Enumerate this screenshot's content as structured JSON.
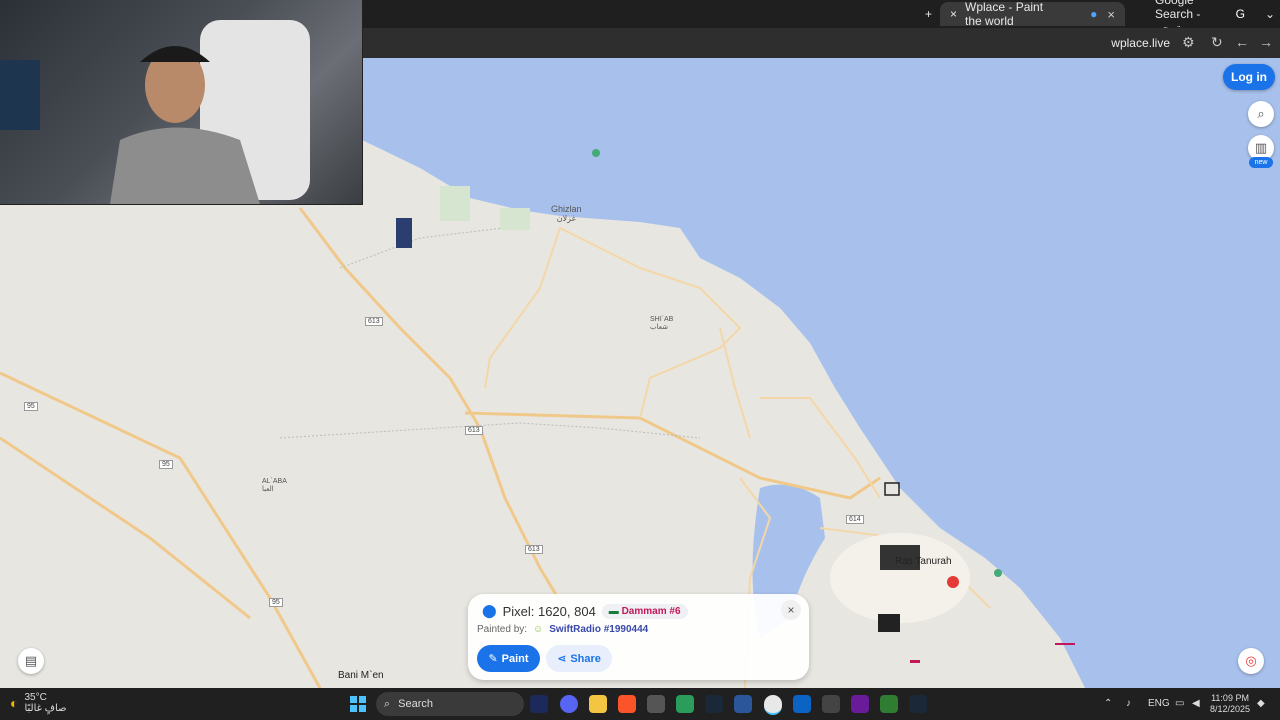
{
  "browser": {
    "tabs": [
      {
        "label": "Wplace - Paint the world",
        "close": "×"
      },
      {
        "label": "Google Search - مترجم"
      }
    ],
    "new_tab": "+",
    "url": "wplace.live"
  },
  "map": {
    "login_label": "Log in",
    "new_badge": "new",
    "places": [
      {
        "name": "Ghizlan",
        "arabic": "غزلان"
      },
      {
        "name": "SHI`AB",
        "arabic": "شعاب"
      },
      {
        "name": "AL`ABA",
        "arabic": "العبا"
      },
      {
        "name": "Ras Tanurah"
      },
      {
        "name": "Bani M`en"
      }
    ],
    "road_numbers": [
      "613",
      "613",
      "613",
      "95",
      "95",
      "95",
      "614"
    ]
  },
  "pixel_panel": {
    "pixel_label": "Pixel: 1620, 804",
    "region": "Dammam #6",
    "painted_by_label": "Painted by:",
    "painter": "SwiftRadio #1990444",
    "paint_label": "Paint",
    "share_label": "Share",
    "close": "×"
  },
  "taskbar": {
    "temperature": "35°C",
    "weather_desc": "صافٍ غالبًا",
    "search_label": "Search",
    "lang": "ENG",
    "time": "11:09 PM",
    "date": "8/12/2025"
  },
  "colors": {
    "sea": "#a8c1ec",
    "land": "#e8e6e1",
    "road": "#f0c98a",
    "accent": "#1a73e8"
  }
}
